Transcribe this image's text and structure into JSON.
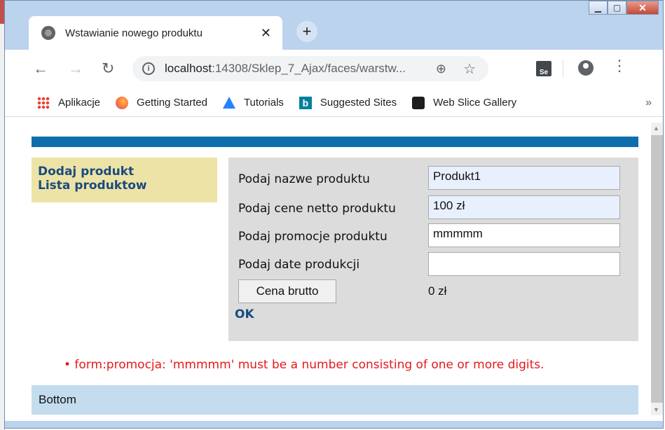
{
  "browser": {
    "tab_title": "Wstawianie nowego produktu",
    "tab_close": "✕",
    "new_tab": "+",
    "url_host": "localhost",
    "url_path": ":14308/Sklep_7_Ajax/faces/warstw...",
    "selenium_label": "Se"
  },
  "bookmarks": [
    {
      "label": "Aplikacje",
      "icon": "apps-grid-icon"
    },
    {
      "label": "Getting Started",
      "icon": "firefox-icon"
    },
    {
      "label": "Tutorials",
      "icon": "atlassian-icon"
    },
    {
      "label": "Suggested Sites",
      "icon": "bing-icon"
    },
    {
      "label": "Web Slice Gallery",
      "icon": "web-slice-icon"
    }
  ],
  "menu": {
    "add_product": "Dodaj produkt",
    "product_list": "Lista produktow"
  },
  "form": {
    "name_label": "Podaj nazwe produktu",
    "name_value": "Produkt1",
    "price_label": "Podaj cene netto produktu",
    "price_value": "100 zł",
    "promo_label": "Podaj promocje produktu",
    "promo_value": "mmmmm",
    "date_label": "Podaj date produkcji",
    "date_value": "",
    "gross_button": "Cena brutto",
    "gross_result": "0 zł",
    "ok_link": "OK"
  },
  "error_message": "• form:promocja: 'mmmmm' must be a number consisting of one or more digits.",
  "footer": "Bottom",
  "colors": {
    "header_bar": "#0e6ead",
    "menu_bg": "#ede3a7",
    "panel_bg": "#dcdcdc",
    "error": "#e5191d",
    "footer_bg": "#c3ddee"
  }
}
